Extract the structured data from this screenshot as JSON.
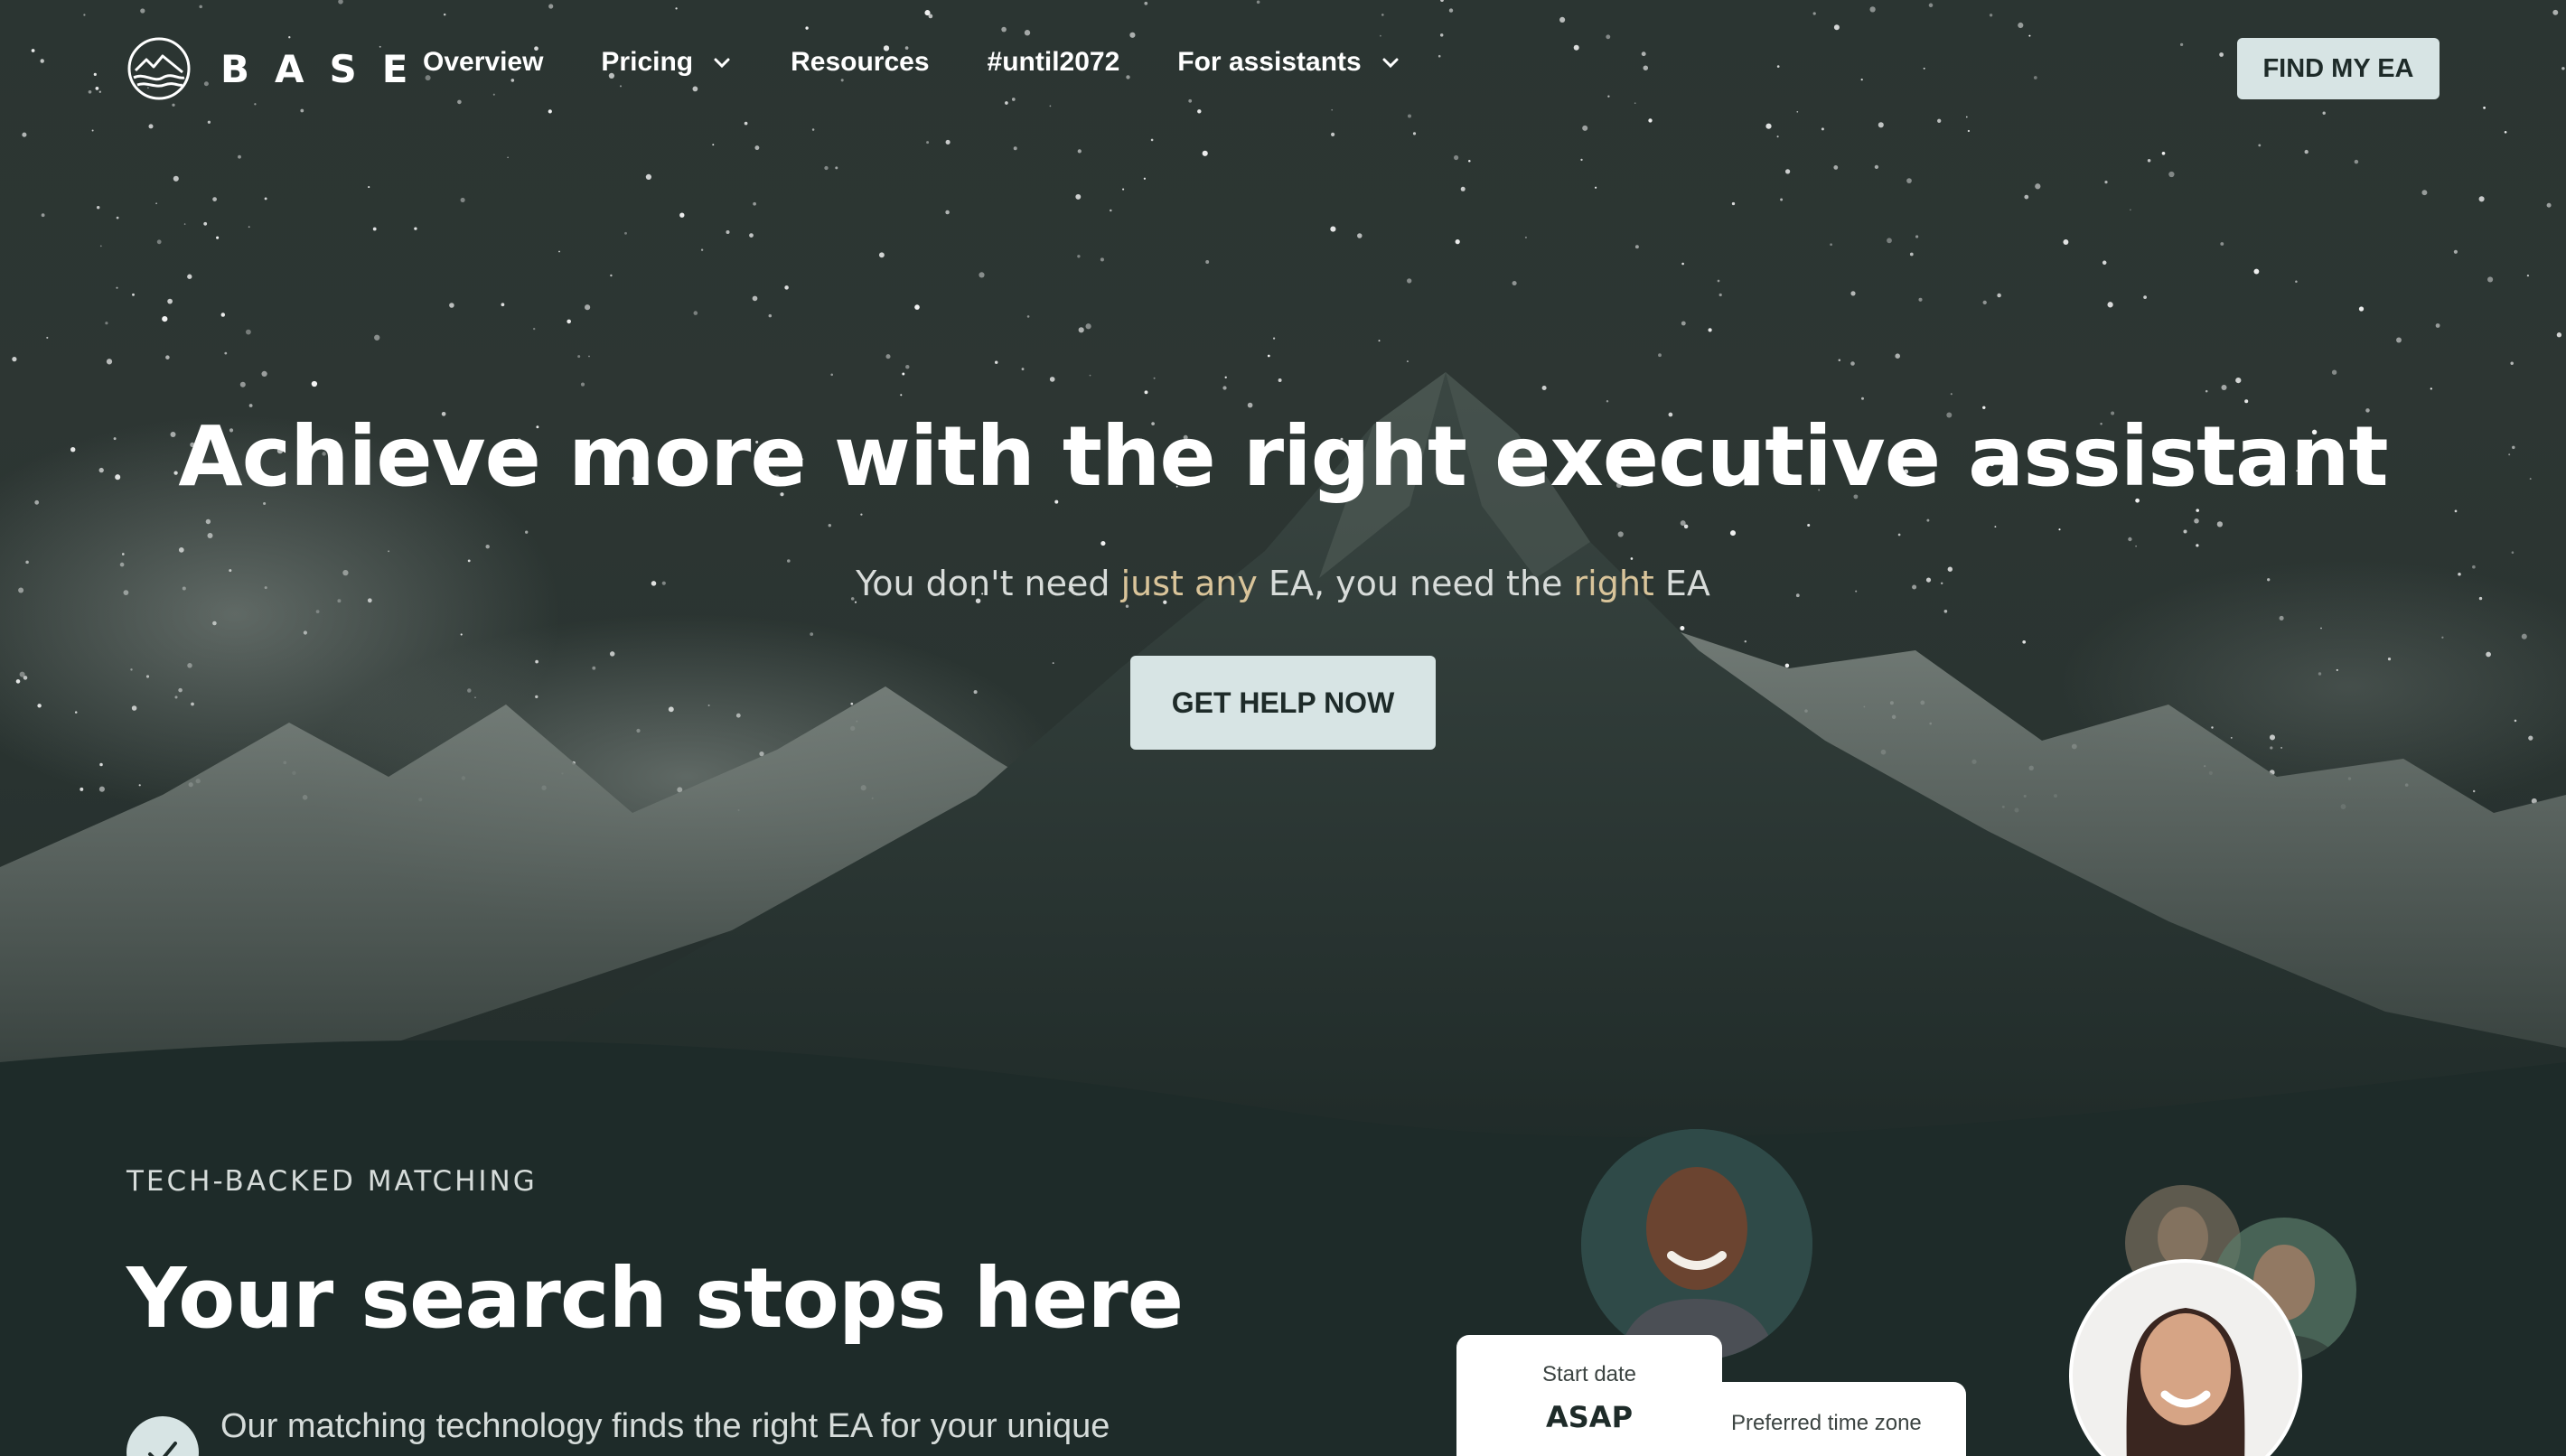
{
  "brand": {
    "name": "BASE"
  },
  "nav": {
    "links": [
      {
        "label": "Overview",
        "dropdown": false
      },
      {
        "label": "Pricing",
        "dropdown": true
      },
      {
        "label": "Resources",
        "dropdown": false
      },
      {
        "label": "#until2072",
        "dropdown": false
      },
      {
        "label": "For assistants",
        "dropdown": true
      }
    ],
    "cta": "FIND MY EA"
  },
  "hero": {
    "title": "Achieve more with the right executive assistant",
    "subtitle": {
      "part1": "You don't need ",
      "accent1": "just any",
      "part2": " EA, you need the ",
      "accent2": "right",
      "part3": " EA"
    },
    "cta": "GET HELP NOW"
  },
  "matching": {
    "eyebrow": "TECH-BACKED MATCHING",
    "title": "Your search stops here",
    "feature": "Our matching technology finds the right EA for your unique",
    "cards": {
      "start_date_label": "Start date",
      "start_date_value": "ASAP",
      "timezone_label": "Preferred time zone"
    }
  },
  "colors": {
    "background": "#1e2b29",
    "button": "#d7e4e4",
    "accent_text": "#d9c49a"
  },
  "icons": [
    "base-logo-icon",
    "chevron-down-icon",
    "check-icon"
  ]
}
